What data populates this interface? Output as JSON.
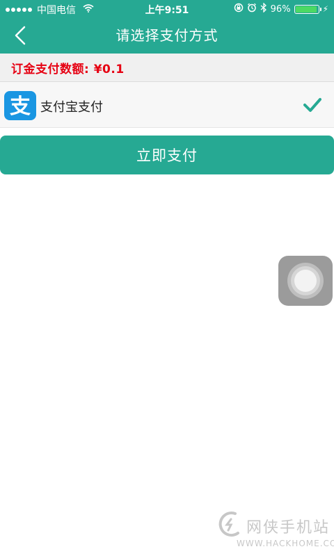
{
  "status_bar": {
    "carrier": "中国电信",
    "time": "上午9:51",
    "battery_percent_text": "96%",
    "battery_level": 0.96
  },
  "nav": {
    "title": "请选择支付方式"
  },
  "order": {
    "amount_text": "订金支付数额: ¥0.1"
  },
  "payment_method": {
    "label": "支付宝支付",
    "icon_glyph": "支",
    "selected": true
  },
  "actions": {
    "pay_label": "立即支付"
  },
  "watermark": {
    "cn_text": "网侠手机站",
    "en_text": "WWW.HACKHOME.COM"
  },
  "colors": {
    "primary": "#26a993",
    "alipay": "#1a96e2",
    "amount": "#e60012",
    "check": "#26a993"
  }
}
